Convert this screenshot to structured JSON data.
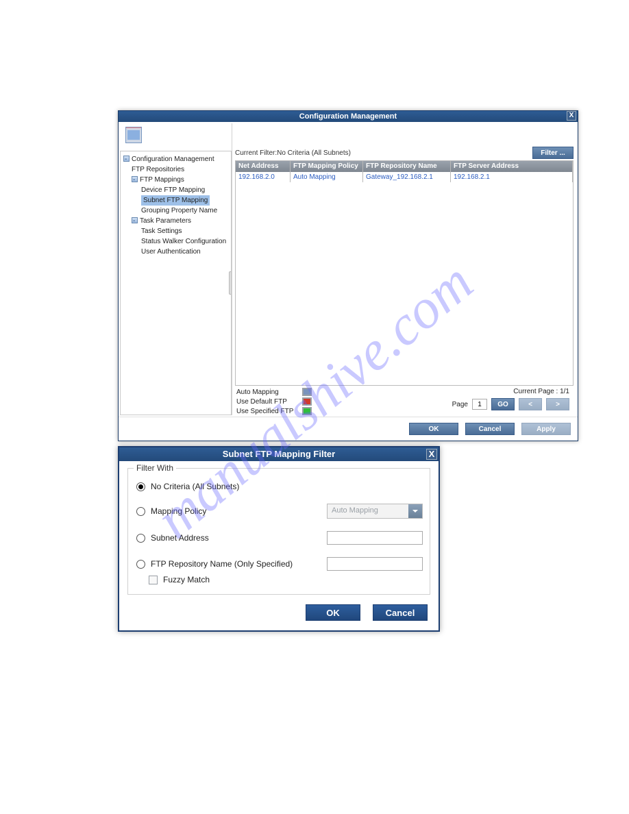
{
  "watermark": "manualshive.com",
  "window1": {
    "title": "Configuration Management",
    "tree": {
      "items": [
        {
          "label": "Configuration Management",
          "level": 0,
          "expander": true
        },
        {
          "label": "FTP Repositories",
          "level": 1,
          "expander": false
        },
        {
          "label": "FTP Mappings",
          "level": 1,
          "expander": true
        },
        {
          "label": "Device FTP Mapping",
          "level": 2,
          "expander": false
        },
        {
          "label": "Subnet FTP Mapping",
          "level": 2,
          "expander": false,
          "selected": true
        },
        {
          "label": "Grouping Property Name",
          "level": 2,
          "expander": false
        },
        {
          "label": "Task Parameters",
          "level": 1,
          "expander": true
        },
        {
          "label": "Task Settings",
          "level": 2,
          "expander": false
        },
        {
          "label": "Status Walker Configuration",
          "level": 2,
          "expander": false
        },
        {
          "label": "User Authentication",
          "level": 2,
          "expander": false
        }
      ]
    },
    "filterLabel": "Current Filter:No Criteria (All Subnets)",
    "filterButton": "Filter ...",
    "columns": [
      "Net Address",
      "FTP Mapping Policy",
      "FTP Repository Name",
      "FTP Server Address"
    ],
    "rows": [
      [
        "192.168.2.0",
        "Auto Mapping",
        "Gateway_192.168.2.1",
        "192.168.2.1"
      ]
    ],
    "legend": [
      {
        "label": "Auto Mapping",
        "color": "#7a94bc"
      },
      {
        "label": "Use Default FTP",
        "color": "#d23a2a"
      },
      {
        "label": "Use Specified FTP",
        "color": "#2fbf3a"
      }
    ],
    "currentPage": "Current Page : 1/1",
    "pageLabel": "Page",
    "pageValue": "1",
    "goLabel": "GO",
    "buttons": {
      "ok": "OK",
      "cancel": "Cancel",
      "apply": "Apply"
    }
  },
  "window2": {
    "title": "Subnet FTP Mapping Filter",
    "groupLabel": "Filter With",
    "options": [
      {
        "label": "No Criteria (All Subnets)",
        "selected": true
      },
      {
        "label": "Mapping Policy",
        "selected": false,
        "comboText": "Auto Mapping"
      },
      {
        "label": "Subnet Address",
        "selected": false
      },
      {
        "label": "FTP Repository Name (Only Specified)",
        "selected": false
      }
    ],
    "fuzzy": "Fuzzy Match",
    "buttons": {
      "ok": "OK",
      "cancel": "Cancel"
    }
  }
}
